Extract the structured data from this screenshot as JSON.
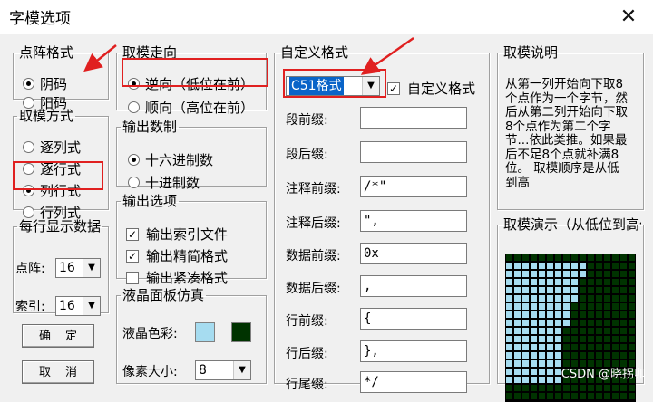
{
  "window": {
    "title": "字模选项",
    "close_glyph": "✕"
  },
  "lattice_format": {
    "label": "点阵格式",
    "options": [
      "阴码",
      "阳码"
    ],
    "selected": 0
  },
  "scan_mode": {
    "label": "取模方式",
    "options": [
      "逐列式",
      "逐行式",
      "列行式",
      "行列式"
    ],
    "selected": 2
  },
  "per_line": {
    "label": "每行显示数据",
    "dot_label": "点阵:",
    "dot_value": "16",
    "index_label": "索引:",
    "index_value": "16"
  },
  "buttons": {
    "ok": "确定",
    "cancel": "取消"
  },
  "direction": {
    "label": "取模走向",
    "options": [
      "逆向（低位在前）",
      "顺向（高位在前）"
    ],
    "selected": 0
  },
  "number_base": {
    "label": "输出数制",
    "options": [
      "十六进制数",
      "十进制数"
    ],
    "selected": 0
  },
  "output_options": {
    "label": "输出选项",
    "items": [
      {
        "label": "输出索引文件",
        "checked": true
      },
      {
        "label": "输出精简格式",
        "checked": true
      },
      {
        "label": "输出紧凑格式",
        "checked": false
      }
    ]
  },
  "lcd": {
    "label": "液晶面板仿真",
    "color_label": "液晶色彩:",
    "pixel_label": "像素大小:",
    "pixel_value": "8",
    "colors": {
      "lit": "#a6dcf0",
      "dark": "#003300"
    }
  },
  "custom_format": {
    "label": "自定义格式",
    "format_value": "C51格式",
    "custom_check_label": "自定义格式",
    "custom_checked": true,
    "fields": [
      {
        "label": "段前缀:",
        "value": ""
      },
      {
        "label": "段后缀:",
        "value": ""
      },
      {
        "label": "注释前缀:",
        "value": "/*\""
      },
      {
        "label": "注释后缀:",
        "value": "\","
      },
      {
        "label": "数据前缀:",
        "value": "0x"
      },
      {
        "label": "数据后缀:",
        "value": ","
      },
      {
        "label": "行前缀:",
        "value": "{"
      },
      {
        "label": "行后缀:",
        "value": "},"
      },
      {
        "label": "行尾缀:",
        "value": "*/"
      }
    ]
  },
  "explanation": {
    "label": "取模说明",
    "text": "从第一列开始向下取8个点作为一个字节，然后从第二列开始向下取8个点作为第二个字节...依此类推。如果最后不足8个点就补满8位。 取模顺序是从低到高"
  },
  "demo": {
    "label": "取模演示（从低位到高位）"
  },
  "watermark": "CSDN @晓拐卯",
  "annotation_color": "#e02020"
}
